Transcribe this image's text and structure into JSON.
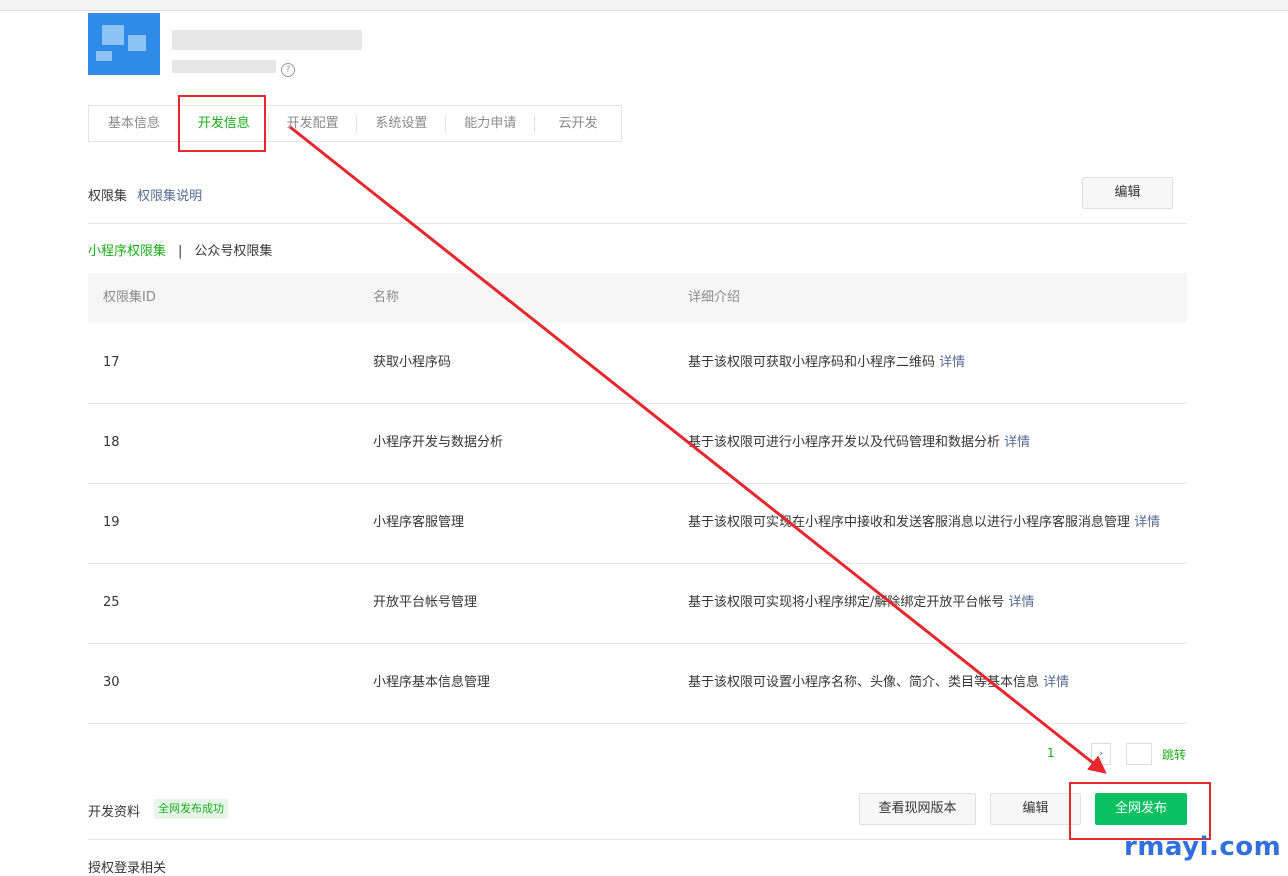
{
  "tabs": [
    {
      "label": "基本信息",
      "active": false
    },
    {
      "label": "开发信息",
      "active": true
    },
    {
      "label": "开发配置",
      "active": false
    },
    {
      "label": "系统设置",
      "active": false
    },
    {
      "label": "能力申请",
      "active": false
    },
    {
      "label": "云开发",
      "active": false
    }
  ],
  "permission": {
    "title": "权限集",
    "help_link": "权限集说明",
    "edit_label": "编辑",
    "subtab_active": "小程序权限集",
    "subtab_separator": "|",
    "subtab_other": "公众号权限集"
  },
  "table": {
    "headers": [
      "权限集ID",
      "名称",
      "详细介绍"
    ],
    "detail_link": "详情",
    "rows": [
      {
        "id": "17",
        "name": "获取小程序码",
        "desc": "基于该权限可获取小程序码和小程序二维码"
      },
      {
        "id": "18",
        "name": "小程序开发与数据分析",
        "desc": "基于该权限可进行小程序开发以及代码管理和数据分析"
      },
      {
        "id": "19",
        "name": "小程序客服管理",
        "desc": "基于该权限可实现在小程序中接收和发送客服消息以进行小程序客服消息管理"
      },
      {
        "id": "25",
        "name": "开放平台帐号管理",
        "desc": "基于该权限可实现将小程序绑定/解除绑定开放平台帐号"
      },
      {
        "id": "30",
        "name": "小程序基本信息管理",
        "desc": "基于该权限可设置小程序名称、头像、简介、类目等基本信息"
      }
    ]
  },
  "pagination": {
    "current": "1",
    "next_icon": "›",
    "jump_label": "跳转"
  },
  "dev_resources": {
    "title": "开发资料",
    "status_badge": "全网发布成功",
    "view_version_label": "查看现网版本",
    "edit_label": "编辑",
    "publish_label": "全网发布"
  },
  "next_section_title": "授权登录相关",
  "watermark": "rmayi.com",
  "colors": {
    "accent_green": "#1aad19",
    "primary_button": "#07c160",
    "link_blue": "#576b95",
    "annotation_red": "#e8262e",
    "watermark_blue": "#2f6fe0"
  }
}
